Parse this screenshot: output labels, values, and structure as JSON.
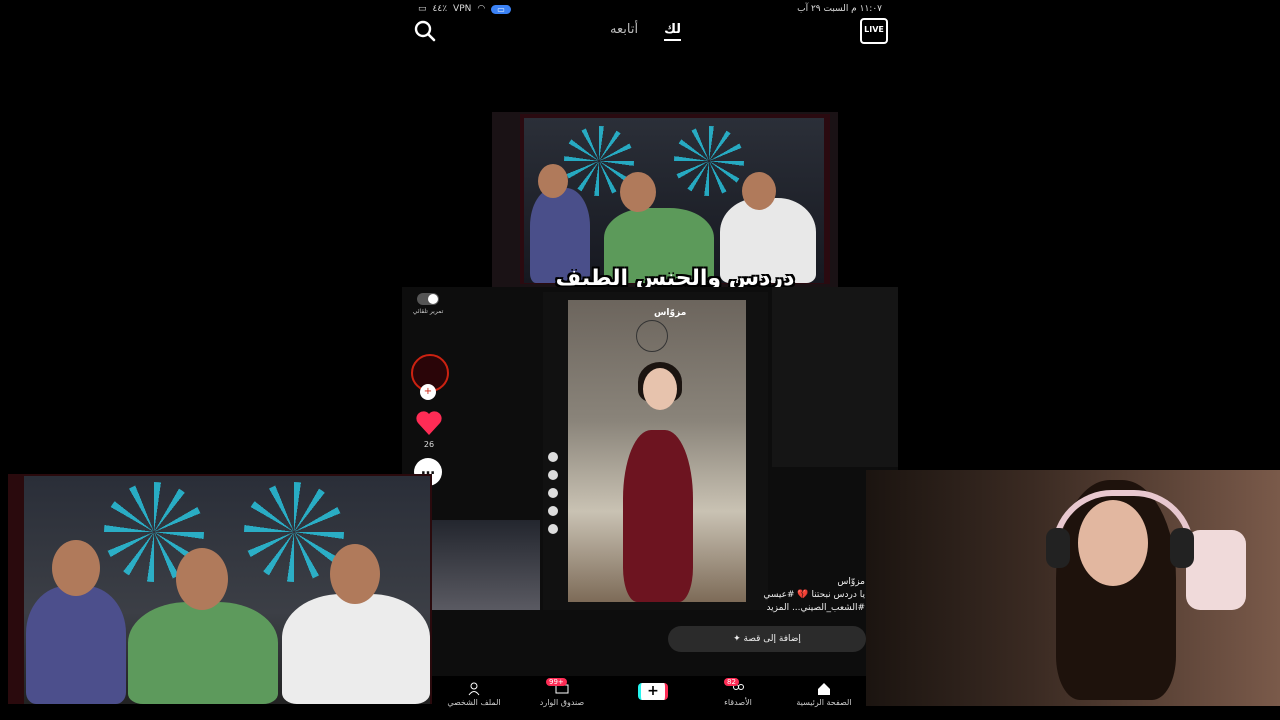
{
  "status_bar": {
    "vpn": "VPN",
    "battery": "٤٤٪",
    "datetime": "١١:٠٧ م  السبت ٢٩ آب"
  },
  "top_nav": {
    "tabs": [
      {
        "label": "لك",
        "active": true
      },
      {
        "label": "أتابعه",
        "active": false
      }
    ],
    "live_label": "LIVE",
    "search_icon": "search-icon"
  },
  "video": {
    "caption": "دردس والجنس الطيف",
    "watermark": "مزوّاس"
  },
  "side_rail": {
    "autoscroll_label": "تمرير تلقائي",
    "likes": "26"
  },
  "description": {
    "username": "مزوّاس",
    "text": "يا دردس نبحتنا 💔 #عيسي #الشعب_الصيني... المزيد"
  },
  "story_button": "إضافة إلى قصة",
  "bottom_nav": {
    "items": [
      {
        "label": "الملف الشخصي",
        "icon": "profile-icon"
      },
      {
        "label": "صندوق الوارد",
        "icon": "inbox-icon",
        "badge": "99+"
      },
      {
        "label": "",
        "icon": "create-icon"
      },
      {
        "label": "الأصدقاء",
        "icon": "friends-icon",
        "badge": "82"
      },
      {
        "label": "الصفحة الرئيسية",
        "icon": "home-icon"
      }
    ]
  },
  "colors": {
    "accent": "#fe2c55",
    "teal": "#25f4ee",
    "background": "#000000"
  }
}
